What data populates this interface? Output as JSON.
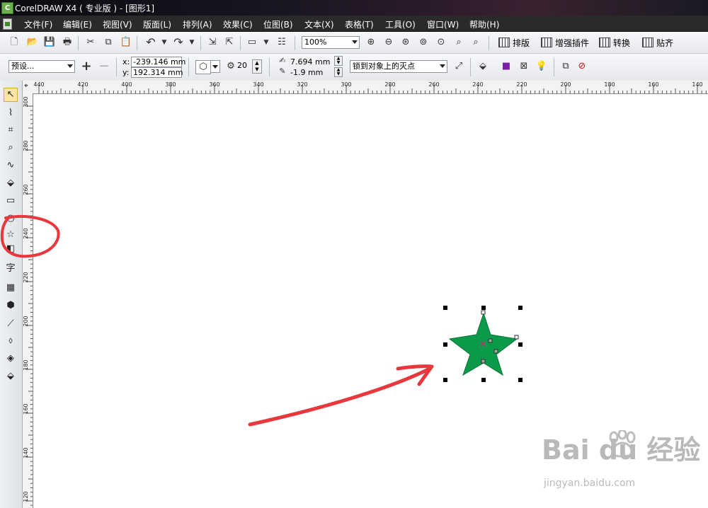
{
  "window": {
    "title": "CorelDRAW X4 ( 专业版 ) - [图形1]"
  },
  "menu": [
    "文件(F)",
    "编辑(E)",
    "视图(V)",
    "版面(L)",
    "排列(A)",
    "效果(C)",
    "位图(B)",
    "文本(X)",
    "表格(T)",
    "工具(O)",
    "窗口(W)",
    "帮助(H)"
  ],
  "toolbar": {
    "zoom": "100%",
    "plugins": [
      "排版",
      "增强插件",
      "转换",
      "贴齐"
    ]
  },
  "property_bar": {
    "preset": "预设...",
    "x_label": "x:",
    "x_value": "-239.146 mm",
    "y_label": "y:",
    "y_value": "192.314 mm",
    "points": "20",
    "width_value": "7.694 mm",
    "height_value": "-1.9 mm",
    "snap_mode": "锁到对象上的灭点"
  },
  "rulers": {
    "horizontal": [
      "440",
      "420",
      "400",
      "380",
      "360",
      "340",
      "320",
      "300",
      "280",
      "260",
      "240",
      "220",
      "200",
      "180",
      "160",
      "140"
    ],
    "vertical": [
      "300",
      "280",
      "260",
      "240",
      "220",
      "200",
      "180",
      "160",
      "140",
      "120"
    ]
  },
  "toolbox": {
    "text_tool_glyph": "字",
    "active_tool": "star-tool"
  },
  "canvas": {
    "shape": "star",
    "star_color": "#0a9a4a",
    "annotation_color": "#e8373d"
  },
  "watermark": {
    "brand": "Bai du 经验",
    "url": "jingyan.baidu.com"
  }
}
